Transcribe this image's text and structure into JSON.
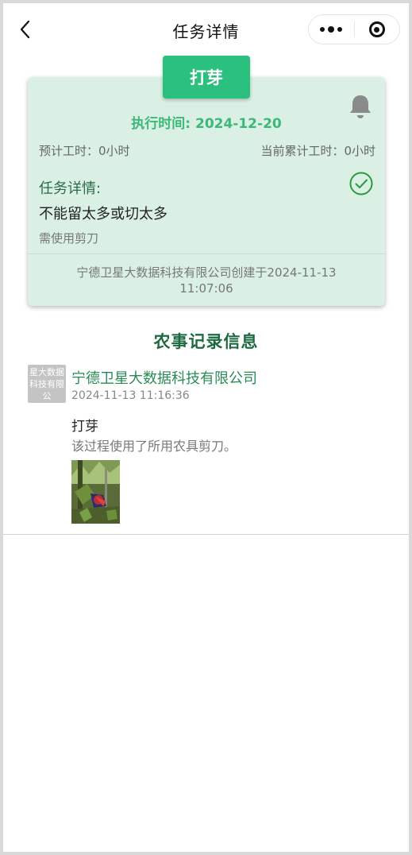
{
  "nav": {
    "title": "任务详情",
    "back_icon": "chevron-left-icon",
    "more_icon": "more-dots-icon",
    "close_icon": "target-circle-icon"
  },
  "task": {
    "tag": "打芽",
    "exec_time_label": "执行时间:",
    "exec_time": "2024-12-20",
    "planned_hours": "预计工时：0小时",
    "accumulated_hours": "当前累计工时：0小时",
    "detail_label": "任务详情:",
    "detail_main": "不能留太多或切太多",
    "detail_sub": "需使用剪刀",
    "created_line1": "宁德卫星大数据科技有限公司创建于2024-11-13",
    "created_line2": "11:07:06",
    "bell_icon": "bell-icon",
    "status_icon": "check-circle-icon"
  },
  "records": {
    "section_title": "农事记录信息",
    "items": [
      {
        "avatar_text": "星大数据科技有限公",
        "company": "宁德卫星大数据科技有限公司",
        "time": "2024-11-13 11:16:36",
        "title": "打芽",
        "description": "该过程使用了所用农具剪刀。"
      }
    ]
  },
  "colors": {
    "card_bg": "#daf0e5",
    "tag_green": "#2cc07e",
    "exec_green": "#3cb878",
    "title_green": "#1d6a42",
    "company_green": "#2a8b55"
  }
}
